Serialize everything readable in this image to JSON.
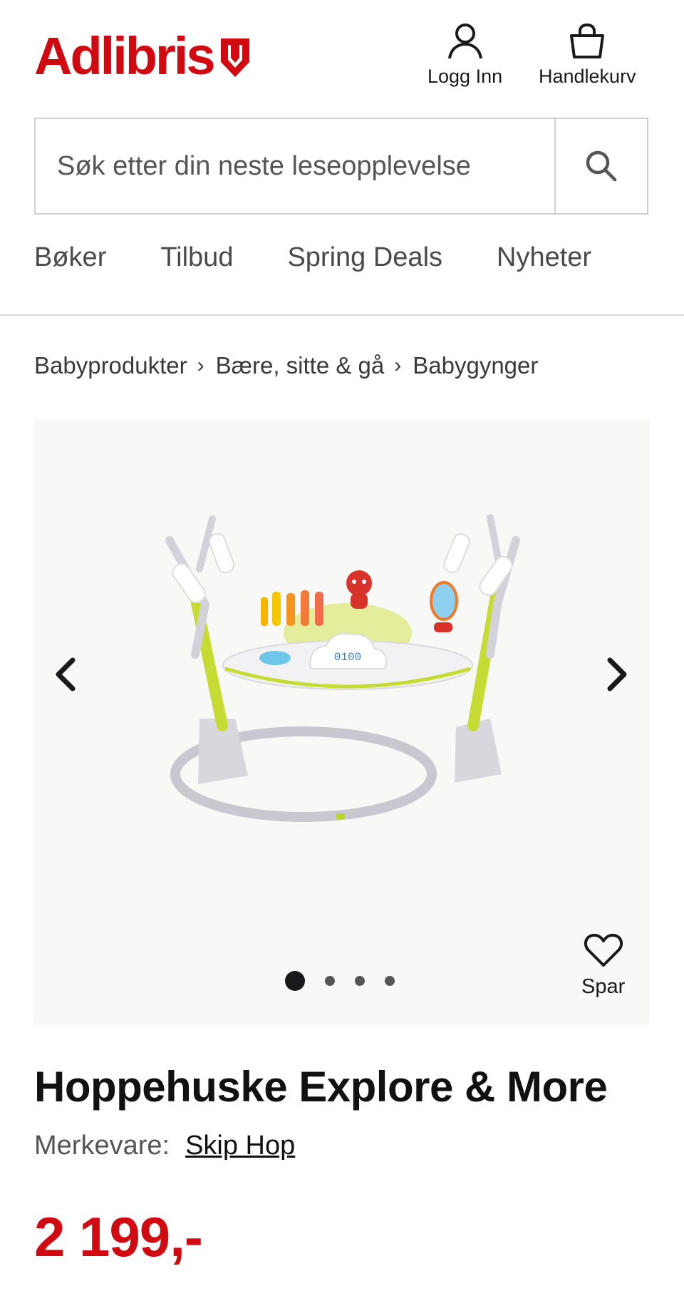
{
  "colors": {
    "brand_red": "#d10a11",
    "text": "#1a1a1a",
    "muted": "#555555"
  },
  "header": {
    "logo_text": "Adlibris",
    "login_label": "Logg Inn",
    "cart_label": "Handlekurv"
  },
  "search": {
    "placeholder": "Søk etter din neste leseopplevelse"
  },
  "nav": {
    "items": [
      "Bøker",
      "Tilbud",
      "Spring Deals",
      "Nyheter"
    ],
    "cut_off_item": "T"
  },
  "breadcrumb": [
    "Babyprodukter",
    "Bære, sitte & gå",
    "Babygynger"
  ],
  "gallery": {
    "image_display": "0100",
    "image_count": 4,
    "active_index": 0,
    "save_label": "Spar"
  },
  "product": {
    "title": "Hoppehuske Explore & More",
    "brand_label": "Merkevare:",
    "brand_name": "Skip Hop",
    "price": "2 199,-"
  }
}
